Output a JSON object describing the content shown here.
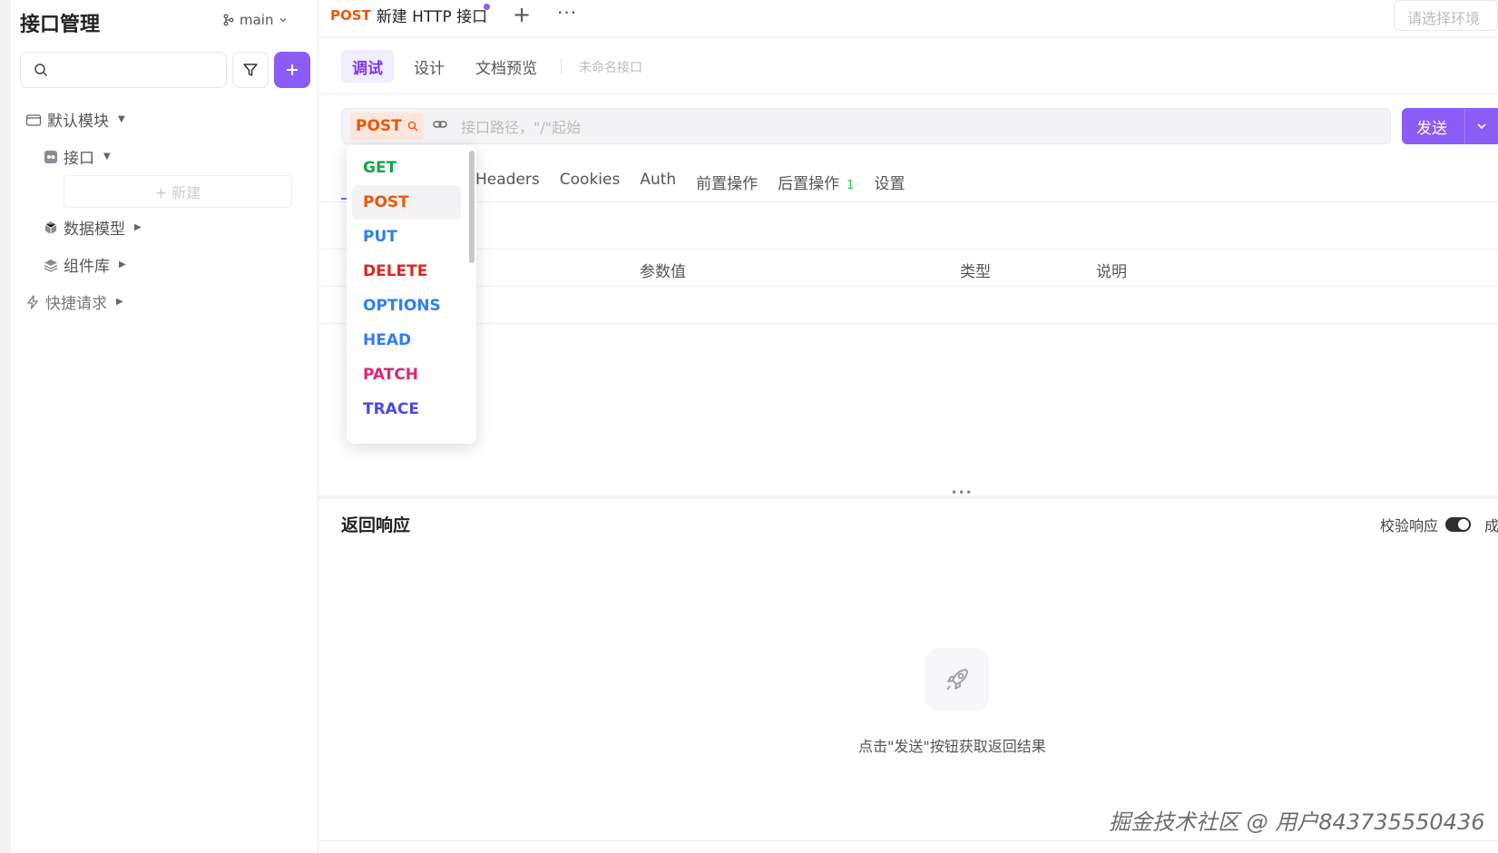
{
  "sidebar": {
    "title": "接口管理",
    "branch": "main",
    "search_placeholder": "",
    "tree": [
      {
        "label": "默认模块",
        "icon": "folder-icon"
      },
      {
        "label": "接口",
        "icon": "api-icon"
      },
      {
        "label": "数据模型",
        "icon": "cube-icon"
      },
      {
        "label": "组件库",
        "icon": "layers-icon"
      },
      {
        "label": "快捷请求",
        "icon": "lightning-icon"
      }
    ],
    "new_label": "+ 新建"
  },
  "tabbar": {
    "tab_method": "POST",
    "tab_title": "新建 HTTP 接口",
    "plus": "+",
    "more": "···",
    "env_placeholder": "请选择环境"
  },
  "mode": {
    "tabs": [
      "调试",
      "设计",
      "文档预览"
    ],
    "active": "调试",
    "name_placeholder": "未命名接口"
  },
  "request": {
    "method": "POST",
    "url_placeholder": "接口路径，\"/\"起始",
    "send_label": "发送",
    "tabs": [
      "Headers",
      "Cookies",
      "Auth",
      "前置操作",
      "后置操作",
      "设置"
    ],
    "post_ops_count": "1",
    "columns": [
      "参数值",
      "类型",
      "说明"
    ]
  },
  "methods": [
    {
      "name": "GET",
      "color": "#16a34a"
    },
    {
      "name": "POST",
      "color": "#ea580c",
      "selected": true
    },
    {
      "name": "PUT",
      "color": "#2f80ed"
    },
    {
      "name": "DELETE",
      "color": "#dc2626"
    },
    {
      "name": "OPTIONS",
      "color": "#2f80ed"
    },
    {
      "name": "HEAD",
      "color": "#2f80ed"
    },
    {
      "name": "PATCH",
      "color": "#db2777"
    },
    {
      "name": "TRACE",
      "color": "#4f46e5"
    }
  ],
  "response": {
    "title": "返回响应",
    "verify_label": "校验响应",
    "verify_extra": "成",
    "empty_text": "点击\"发送\"按钮获取返回结果"
  },
  "watermark": "掘金技术社区 @ 用户843735550436",
  "colors": {
    "accent": "#8b5cf6",
    "post": "#ea580c"
  }
}
